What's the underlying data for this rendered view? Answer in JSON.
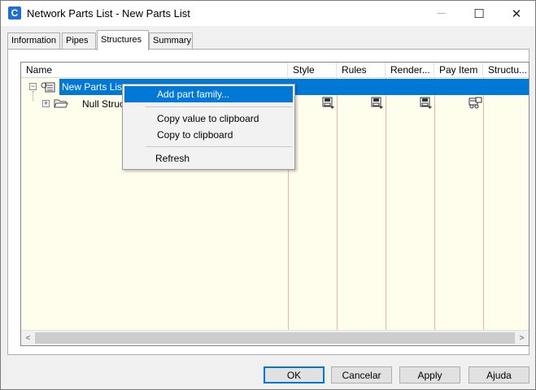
{
  "window": {
    "app_icon_letter": "C",
    "title": "Network Parts List - New Parts List",
    "minimize_glyph": "─",
    "maximize_glyph": "☐",
    "close_glyph": "✕"
  },
  "tabs": [
    {
      "label": "Information",
      "active": false
    },
    {
      "label": "Pipes",
      "active": false
    },
    {
      "label": "Structures",
      "active": true
    },
    {
      "label": "Summary",
      "active": false
    }
  ],
  "grid": {
    "columns": [
      "Name",
      "Style",
      "Rules",
      "Render...",
      "Pay Item",
      "Structu..."
    ],
    "rows": [
      {
        "name": "New Parts List",
        "selected": true,
        "expander": "⊟"
      },
      {
        "name": "Null Struct",
        "selected": false,
        "expander": "⊞"
      }
    ],
    "icons": {
      "parts_list": "parts-list-icon",
      "folder": "folder-icon",
      "style": "style-save-icon",
      "rules": "rules-save-icon",
      "render": "render-save-icon",
      "pay_item": "pay-item-icon"
    }
  },
  "context_menu": {
    "items": [
      {
        "label": "Add part family...",
        "highlighted": true
      },
      {
        "label": "Copy value to clipboard",
        "highlighted": false
      },
      {
        "label": "Copy to clipboard",
        "highlighted": false
      },
      {
        "label": "Refresh",
        "highlighted": false
      }
    ]
  },
  "scrollbar": {
    "left_arrow": "<",
    "right_arrow": ">"
  },
  "buttons": {
    "ok": "OK",
    "cancel": "Cancelar",
    "apply": "Apply",
    "help": "Ajuda"
  },
  "colors": {
    "selection": "#0078d7",
    "grid_background": "#fffdeb",
    "column_line": "#f0b0b0"
  }
}
